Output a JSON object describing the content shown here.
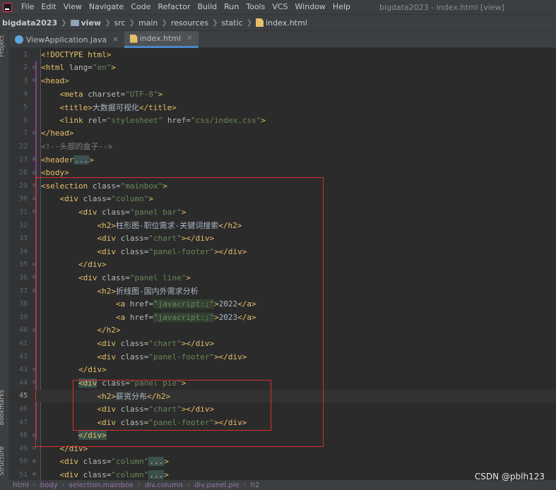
{
  "menubar": {
    "items": [
      "File",
      "Edit",
      "View",
      "Navigate",
      "Code",
      "Refactor",
      "Build",
      "Run",
      "Tools",
      "VCS",
      "Window",
      "Help"
    ],
    "window_title": "bigdata2023 - index.html [view]"
  },
  "breadcrumb": {
    "items": [
      "bigdata2023",
      "view",
      "src",
      "main",
      "resources",
      "static",
      "index.html"
    ]
  },
  "toolstrip": {
    "project": "Project",
    "bookmarks": "Bookmarks",
    "structure": "Structure"
  },
  "tabs": [
    {
      "label": "ViewApplication.java",
      "icon": "java-class-icon",
      "active": false
    },
    {
      "label": "index.html",
      "icon": "html-file-icon",
      "active": true
    }
  ],
  "editor": {
    "current_line": 45,
    "lines": [
      {
        "n": "1"
      },
      {
        "n": "2"
      },
      {
        "n": "3"
      },
      {
        "n": "4"
      },
      {
        "n": "5"
      },
      {
        "n": "6"
      },
      {
        "n": "7"
      },
      {
        "n": "22"
      },
      {
        "n": "23"
      },
      {
        "n": "28"
      },
      {
        "n": "29"
      },
      {
        "n": "30"
      },
      {
        "n": "31"
      },
      {
        "n": "32"
      },
      {
        "n": "33"
      },
      {
        "n": "34"
      },
      {
        "n": "35"
      },
      {
        "n": "36"
      },
      {
        "n": "37"
      },
      {
        "n": "38"
      },
      {
        "n": "39"
      },
      {
        "n": "40"
      },
      {
        "n": "41"
      },
      {
        "n": "42"
      },
      {
        "n": "43"
      },
      {
        "n": "44"
      },
      {
        "n": "45"
      },
      {
        "n": "46"
      },
      {
        "n": "47"
      },
      {
        "n": "48"
      },
      {
        "n": "49"
      },
      {
        "n": "50"
      },
      {
        "n": "51"
      }
    ],
    "code": {
      "l1": "<!DOCTYPE html>",
      "l2_tag": "<html",
      "l2_attr": " lang=",
      "l2_val": "\"en\"",
      "l2_end": ">",
      "l3": "<head>",
      "l4_tag": "<meta",
      "l4_attr": " charset=",
      "l4_val": "\"UTF-8\"",
      "l4_end": ">",
      "l5_open": "<title>",
      "l5_text": "大数据可视化",
      "l5_close": "</title>",
      "l6_tag": "<link",
      "l6_attr1": " rel=",
      "l6_val1": "\"stylesheet\"",
      "l6_attr2": " href=",
      "l6_val2": "\"css/index.css\"",
      "l6_end": ">",
      "l7": "</head>",
      "l22": "<!--头部的盒子-->",
      "l23_tag": "<header",
      "l23_fold": "...",
      "l23_end": ">",
      "l28": "<body>",
      "l29_tag": "<selection",
      "l29_attr": " class=",
      "l29_val": "\"mainbox\"",
      "l29_end": ">",
      "l30_tag": "<div",
      "l30_attr": " class=",
      "l30_val": "\"column\"",
      "l30_end": ">",
      "l31_tag": "<div",
      "l31_attr": " class=",
      "l31_val": "\"panel bar\"",
      "l31_end": ">",
      "l32_open": "<h2>",
      "l32_text": "柱形图-职位需求-关键词搜索",
      "l32_close": "</h2>",
      "l33_tag": "<div",
      "l33_attr": " class=",
      "l33_val": "\"chart\"",
      "l33_end": "></div>",
      "l34_tag": "<div",
      "l34_attr": " class=",
      "l34_val": "\"panel-footer\"",
      "l34_end": "></div>",
      "l35": "</div>",
      "l36_tag": "<div",
      "l36_attr": " class=",
      "l36_val": "\"panel line\"",
      "l36_end": ">",
      "l37_open": "<h2>",
      "l37_text": "折线图-国内外需求分析",
      "l38_tag": "<a",
      "l38_attr": " href=",
      "l38_val": "\"javacript:;\"",
      "l38_gt": ">",
      "l38_text": "2022",
      "l38_close": "</a>",
      "l39_tag": "<a",
      "l39_attr": " href=",
      "l39_val": "\"javacript:;\"",
      "l39_gt": ">",
      "l39_text": "2023",
      "l39_close": "</a>",
      "l40": "</h2>",
      "l41_tag": "<div",
      "l41_attr": " class=",
      "l41_val": "\"chart\"",
      "l41_end": "></div>",
      "l42_tag": "<div",
      "l42_attr": " class=",
      "l42_val": "\"panel-footer\"",
      "l42_end": "></div>",
      "l43": "</div>",
      "l44_tag": "<div",
      "l44_attr": " class=",
      "l44_val": "\"panel pie\"",
      "l44_end": ">",
      "l45_open": "<h2>",
      "l45_text": "薪资分布",
      "l45_close": "</h2>",
      "l46_tag": "<div",
      "l46_attr": " class=",
      "l46_val": "\"chart\"",
      "l46_end": "></div>",
      "l47_tag": "<div",
      "l47_attr": " class=",
      "l47_val": "\"panel-footer\"",
      "l47_end": "></div>",
      "l48": "</div>",
      "l49": "</div>",
      "l50_tag": "<div",
      "l50_attr": " class=",
      "l50_val": "\"column\"",
      "l50_fold": "...",
      "l50_end": ">",
      "l51_tag": "<div",
      "l51_attr": " class=",
      "l51_val": "\"column\"",
      "l51_fold": "...",
      "l51_end": ">"
    }
  },
  "status_breadcrumb": {
    "items": [
      "html",
      "body",
      "selection.mainbox",
      "div.column",
      "div.panel.pie",
      "h2"
    ]
  },
  "watermark": "CSDN @pblh123",
  "colors": {
    "annotation_red": "#d8302b",
    "tag": "#e8bf6a",
    "string": "#6a8759",
    "comment": "#808080"
  }
}
